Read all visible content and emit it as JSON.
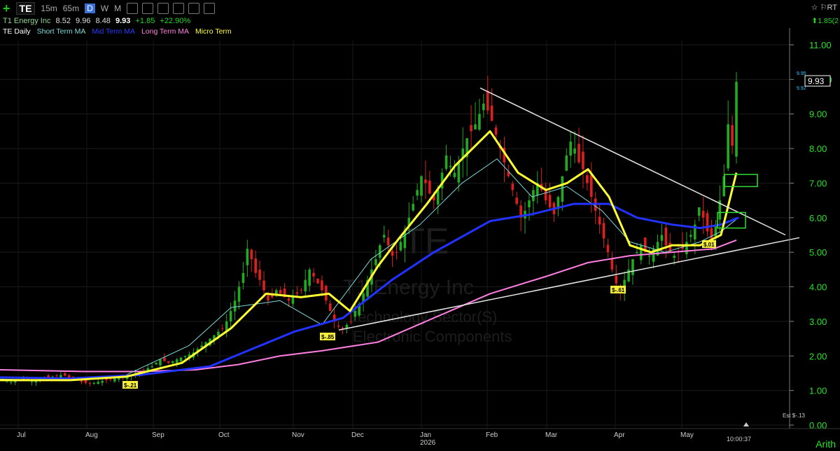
{
  "toolbar": {
    "symbol": "TE",
    "timeframes": [
      "15m",
      "65m",
      "D",
      "W",
      "M"
    ],
    "active_timeframe": "D",
    "icons": [
      "plus-icon",
      "t-chart-icon",
      "s-icon",
      "settings-icon",
      "draw-icon",
      "link-icon",
      "share-icon"
    ],
    "right": "☆ ⚐RT"
  },
  "quote": {
    "name": "T1 Energy Inc",
    "open": "8.52",
    "high": "9.96",
    "low": "8.48",
    "last": "9.93",
    "change": "+1.85",
    "change_pct": "+22.90%",
    "right_snippet": "⬆1.85(2"
  },
  "legend": [
    {
      "label": "TE Daily",
      "color": "#ffffff"
    },
    {
      "label": "Short Term MA",
      "color": "#7fd8d8"
    },
    {
      "label": "Mid Term MA",
      "color": "#2a3bff"
    },
    {
      "label": "Long Term MA",
      "color": "#ff7fe0"
    },
    {
      "label": "Micro Term",
      "color": "#ffff33"
    }
  ],
  "watermark": {
    "symbol": "TE",
    "name": "T1 Energy Inc",
    "sector": "Technology Sector(S)",
    "industry": "Electronic Components"
  },
  "price_tag": {
    "last": "9.93",
    "high": "9.95",
    "low": "9.92"
  },
  "earnings": [
    "$-.21",
    "$-.85",
    "$-.61",
    "$.01"
  ],
  "status": {
    "clock": "10:00:37",
    "scale": "Arith",
    "est": "Est $-.13"
  },
  "chart_data": {
    "type": "candlestick",
    "title": "",
    "ylim": [
      0,
      11.5
    ],
    "yticks": [
      "0.00",
      "1.00",
      "2.00",
      "3.00",
      "4.00",
      "5.00",
      "6.00",
      "7.00",
      "8.00",
      "9.00",
      "10.00",
      "11.00"
    ],
    "xticks": [
      "Jul",
      "Aug",
      "Sep",
      "Oct",
      "Nov",
      "Dec",
      "Jan",
      "Feb",
      "Mar",
      "Apr",
      "May"
    ],
    "year_label": "2026",
    "candle_colors": {
      "up": "#22aa22",
      "down": "#dd1f1f"
    },
    "closes": [
      1.3,
      1.28,
      1.25,
      1.3,
      1.32,
      1.35,
      1.3,
      1.28,
      1.33,
      1.35,
      1.38,
      1.36,
      1.4,
      1.42,
      1.45,
      1.43,
      1.38,
      1.35,
      1.3,
      1.25,
      1.22,
      1.2,
      1.22,
      1.25,
      1.28,
      1.3,
      1.32,
      1.35,
      1.38,
      1.4,
      1.42,
      1.45,
      1.5,
      1.55,
      1.6,
      1.65,
      1.7,
      1.8,
      1.9,
      1.85,
      1.8,
      1.85,
      1.9,
      1.95,
      2.0,
      2.05,
      2.1,
      2.2,
      2.3,
      2.4,
      2.5,
      2.6,
      2.7,
      2.8,
      3.0,
      3.3,
      3.6,
      4.0,
      4.4,
      5.1,
      4.8,
      4.4,
      4.2,
      3.9,
      3.6,
      3.7,
      3.9,
      3.8,
      3.7,
      3.6,
      3.7,
      3.8,
      3.9,
      4.2,
      4.5,
      4.3,
      4.1,
      3.9,
      3.6,
      3.3,
      3.0,
      2.85,
      2.8,
      2.9,
      3.0,
      3.3,
      3.5,
      3.8,
      4.2,
      4.5,
      4.8,
      5.2,
      5.5,
      5.2,
      4.9,
      5.0,
      5.3,
      5.6,
      6.0,
      6.4,
      6.8,
      7.2,
      7.0,
      6.7,
      6.5,
      6.8,
      7.3,
      7.8,
      7.5,
      7.3,
      7.6,
      8.0,
      8.3,
      8.5,
      8.7,
      9.0,
      9.3,
      9.1,
      8.8,
      8.4,
      8.0,
      7.6,
      7.2,
      6.8,
      6.4,
      6.0,
      6.2,
      6.5,
      6.8,
      7.0,
      6.8,
      6.5,
      6.3,
      6.1,
      6.6,
      7.2,
      7.8,
      8.2,
      8.0,
      7.6,
      7.4,
      7.0,
      6.6,
      6.2,
      5.8,
      5.4,
      5.0,
      4.5,
      4.1,
      3.9,
      4.2,
      4.5,
      4.8,
      5.0,
      5.2,
      5.0,
      4.9,
      5.1,
      5.3,
      5.5,
      5.2,
      5.0,
      4.9,
      5.0,
      5.1,
      5.3,
      5.5,
      5.8,
      6.3,
      6.0,
      5.6,
      5.4,
      5.8,
      6.5,
      7.2,
      8.7,
      8.08,
      9.93
    ],
    "mas": {
      "short": [
        [
          0,
          1.33
        ],
        [
          90,
          1.3
        ],
        [
          180,
          1.45
        ],
        [
          270,
          2.3
        ],
        [
          330,
          3.4
        ],
        [
          400,
          3.6
        ],
        [
          460,
          2.9
        ],
        [
          530,
          4.8
        ],
        [
          600,
          5.8
        ],
        [
          660,
          7.0
        ],
        [
          710,
          7.7
        ],
        [
          760,
          6.6
        ],
        [
          810,
          6.9
        ],
        [
          860,
          6.2
        ],
        [
          900,
          5.3
        ],
        [
          950,
          5.0
        ],
        [
          1000,
          5.3
        ],
        [
          1030,
          5.6
        ],
        [
          1055,
          6.0
        ]
      ],
      "mid": [
        [
          0,
          1.38
        ],
        [
          100,
          1.35
        ],
        [
          200,
          1.45
        ],
        [
          300,
          1.7
        ],
        [
          360,
          2.2
        ],
        [
          420,
          2.7
        ],
        [
          490,
          3.1
        ],
        [
          560,
          4.2
        ],
        [
          620,
          5.0
        ],
        [
          700,
          5.9
        ],
        [
          760,
          6.1
        ],
        [
          820,
          6.4
        ],
        [
          870,
          6.4
        ],
        [
          910,
          6.0
        ],
        [
          960,
          5.8
        ],
        [
          1000,
          5.7
        ],
        [
          1030,
          5.8
        ],
        [
          1055,
          6.0
        ]
      ],
      "long": [
        [
          0,
          1.6
        ],
        [
          120,
          1.55
        ],
        [
          200,
          1.55
        ],
        [
          280,
          1.6
        ],
        [
          340,
          1.75
        ],
        [
          400,
          2.0
        ],
        [
          460,
          2.15
        ],
        [
          540,
          2.4
        ],
        [
          620,
          3.1
        ],
        [
          700,
          3.8
        ],
        [
          780,
          4.3
        ],
        [
          840,
          4.7
        ],
        [
          900,
          4.9
        ],
        [
          960,
          5.0
        ],
        [
          1020,
          5.1
        ],
        [
          1052,
          5.35
        ]
      ],
      "micro": [
        [
          0,
          1.3
        ],
        [
          100,
          1.3
        ],
        [
          180,
          1.4
        ],
        [
          260,
          1.8
        ],
        [
          330,
          2.8
        ],
        [
          380,
          3.8
        ],
        [
          430,
          3.7
        ],
        [
          470,
          3.8
        ],
        [
          500,
          3.3
        ],
        [
          540,
          4.6
        ],
        [
          570,
          5.4
        ],
        [
          610,
          6.4
        ],
        [
          650,
          7.5
        ],
        [
          700,
          8.5
        ],
        [
          740,
          7.3
        ],
        [
          780,
          6.8
        ],
        [
          810,
          7.0
        ],
        [
          840,
          7.4
        ],
        [
          870,
          6.6
        ],
        [
          900,
          5.2
        ],
        [
          930,
          5.0
        ],
        [
          960,
          5.2
        ],
        [
          1000,
          5.2
        ],
        [
          1030,
          5.5
        ],
        [
          1052,
          7.3
        ]
      ]
    },
    "trendlines": [
      {
        "from": [
          686,
          9.75
        ],
        "to": [
          1122,
          5.5
        ]
      },
      {
        "from": [
          484,
          2.75
        ],
        "to": [
          1142,
          5.42
        ]
      }
    ],
    "boxes": [
      {
        "x": [
          1035,
          1082
        ],
        "y": [
          6.9,
          7.25
        ]
      },
      {
        "x": [
          1025,
          1065
        ],
        "y": [
          5.7,
          6.15
        ]
      }
    ]
  }
}
